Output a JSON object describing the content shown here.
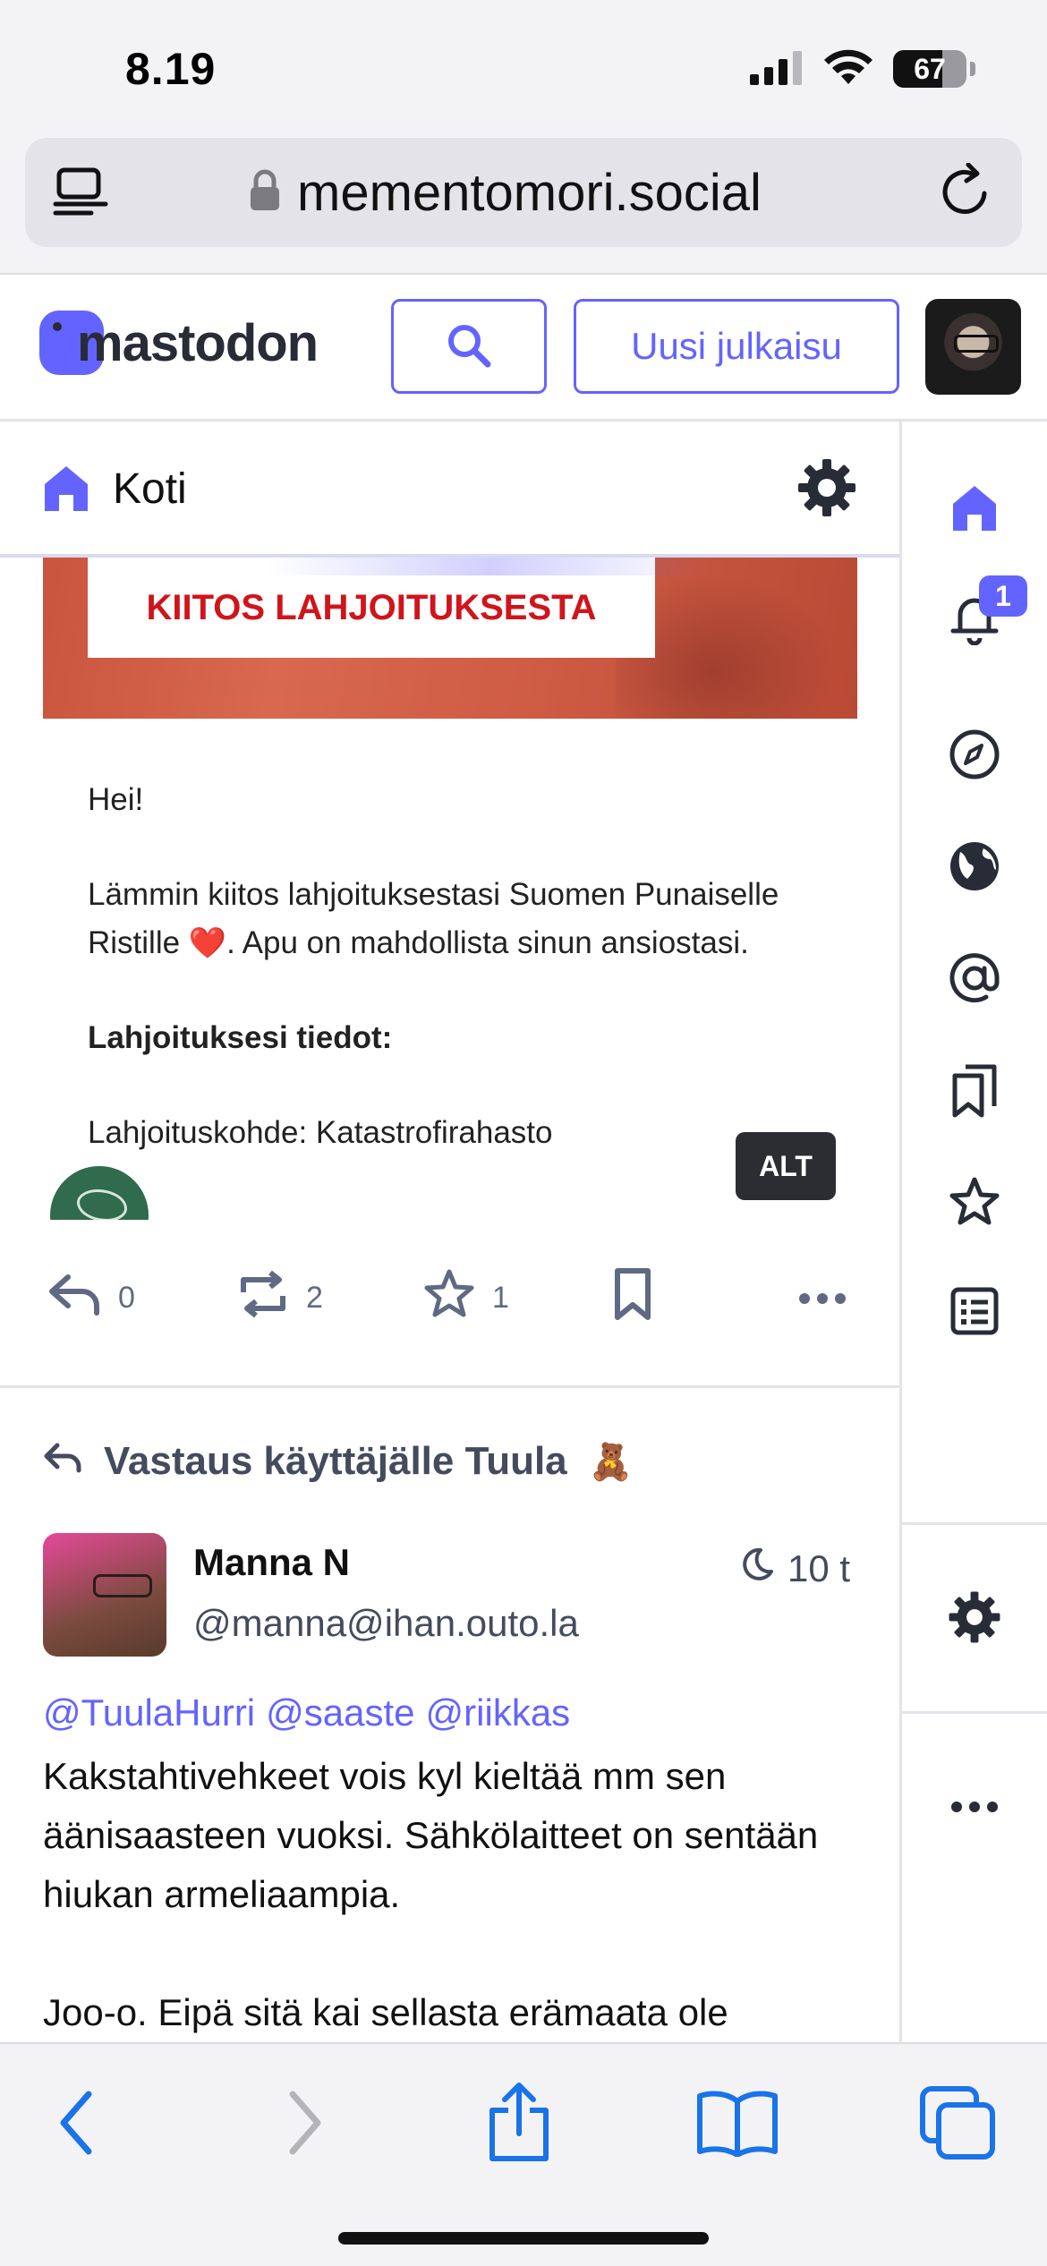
{
  "status_bar": {
    "time": "8.19",
    "battery_level": "67",
    "battery_fraction": 0.67,
    "icons": [
      "signal-icon",
      "wifi-icon",
      "battery-icon"
    ]
  },
  "browser": {
    "url": "mementomori.social",
    "icons": [
      "reader-mode-icon",
      "lock-icon",
      "reload-icon"
    ]
  },
  "header": {
    "logo_text": "mastodon",
    "new_post_label": "Uusi julkaisu",
    "icons": [
      "search-icon"
    ]
  },
  "column": {
    "title": "Koti",
    "icons": [
      "home-icon",
      "settings-icon"
    ]
  },
  "rail": {
    "notification_count": "1",
    "items": [
      "home-icon",
      "bell-icon",
      "explore-icon",
      "globe-icon",
      "at-icon",
      "bookmarks-icon",
      "star-icon",
      "list-icon",
      "settings-icon",
      "more-icon"
    ]
  },
  "post1": {
    "banner_text": "KIITOS LAHJOITUKSESTA",
    "email": {
      "greeting": "Hei!",
      "body_before_heart": "Lämmin kiitos lahjoituksestasi Suomen Punaiselle Ristille",
      "heart": "❤️",
      "body_after_heart": ". Apu on mahdollista sinun ansiostasi.",
      "details_heading": "Lahjoituksesi tiedot:",
      "target_line": "Lahjoituskohde: Katastrofirahasto"
    },
    "alt_label": "ALT",
    "actions": {
      "replies": "0",
      "boosts": "2",
      "favourites": "1"
    }
  },
  "post2": {
    "reply_to": "Vastaus käyttäjälle Tuula",
    "reply_to_emoji": "🧸",
    "author_name": "Manna N",
    "author_handle": "@manna@ihan.outo.la",
    "time": "10 t",
    "mentions": [
      "@TuulaHurri",
      "@saaste",
      "@riikkas"
    ],
    "paragraphs": [
      "Kakstahtivehkeet vois kyl kieltää mm sen äänisaasteen vuoksi. Sähkölaitteet on sentään hiukan armeliaampia.",
      "Joo-o. Eipä sitä kai sellasta erämaata ole"
    ]
  },
  "toolbar": {
    "items": [
      "back-icon",
      "forward-icon",
      "share-icon",
      "bookmarks-book-icon",
      "tabs-icon"
    ]
  },
  "colors": {
    "accent": "#6364ff",
    "muted": "#606984",
    "red_cross": "#d0141c"
  }
}
